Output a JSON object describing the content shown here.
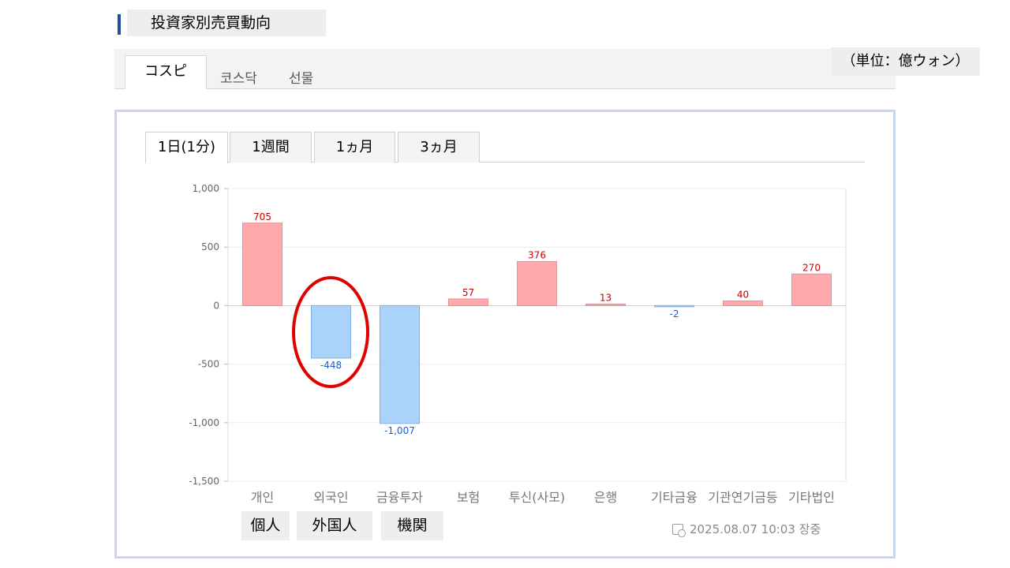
{
  "header": {
    "title": "投資家別売買動向"
  },
  "market_tabs": [
    {
      "label": "コスピ",
      "active": true
    },
    {
      "label": "코스닥",
      "active": false
    },
    {
      "label": "선물",
      "active": false
    }
  ],
  "unit_note": "（単位：億ウォン）",
  "period_tabs": [
    {
      "label": "1日(1分)",
      "active": true
    },
    {
      "label": "1週間",
      "active": false
    },
    {
      "label": "1ヵ月",
      "active": false
    },
    {
      "label": "3ヵ月",
      "active": false
    }
  ],
  "annotations": {
    "translations": [
      "個人",
      "外国人",
      "機関"
    ],
    "highlight_category": "외국인",
    "highlight_color": "#e00000"
  },
  "timestamp": "2025.08.07 10:03 장중",
  "colors": {
    "positive_fill": "#ffa9ad",
    "positive_stroke": "#f08a90",
    "positive_label": "#cc0000",
    "negative_fill": "#aad3fb",
    "negative_stroke": "#7fb0ee",
    "negative_label": "#1a5fcc"
  },
  "chart_data": {
    "type": "bar",
    "categories": [
      "개인",
      "외국인",
      "금융투자",
      "보험",
      "투신(사모)",
      "은행",
      "기타금융",
      "기관연기금등",
      "기타법인"
    ],
    "values": [
      705,
      -448,
      -1007,
      57,
      376,
      13,
      -2,
      40,
      270
    ],
    "data_labels": [
      "705",
      "-448",
      "-1,007",
      "57",
      "376",
      "13",
      "-2",
      "40",
      "270"
    ],
    "yticks": [
      1000,
      500,
      0,
      -500,
      -1000,
      -1500
    ],
    "ytick_labels": [
      "1,000",
      "500",
      "0",
      "-500",
      "-1,000",
      "-1,500"
    ],
    "ylim": [
      -1500,
      1000
    ],
    "grid": true,
    "title": "",
    "xlabel": "",
    "ylabel": ""
  }
}
